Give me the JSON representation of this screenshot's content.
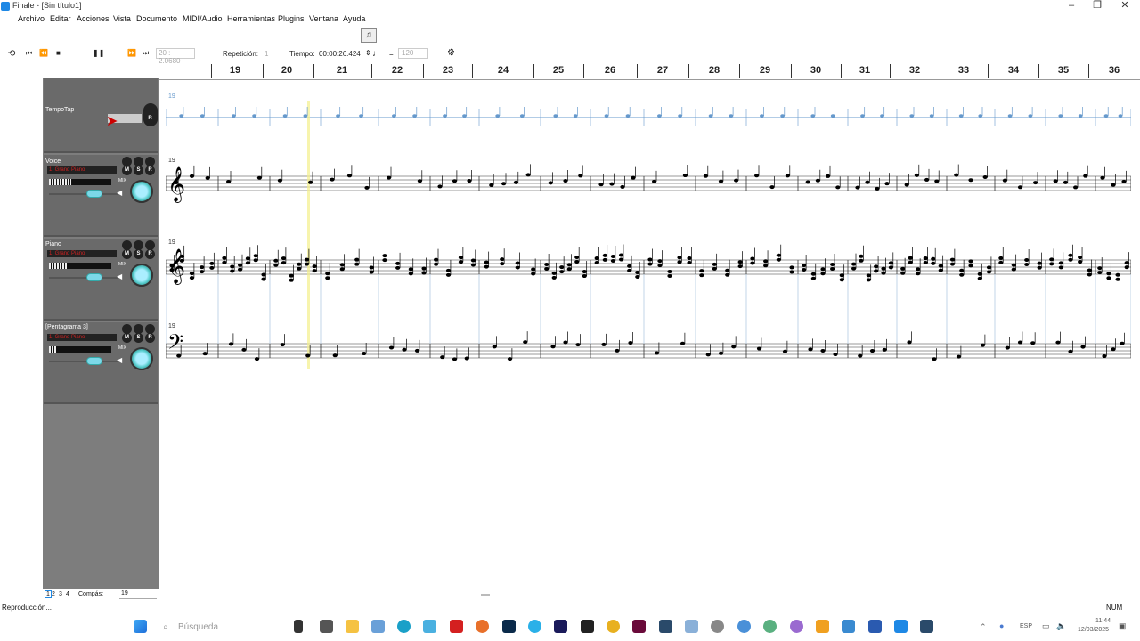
{
  "window": {
    "title": "Finale - [Sin título1]"
  },
  "menu": [
    "Archivo",
    "Editar",
    "Acciones",
    "Vista",
    "Documento",
    "MIDI/Audio",
    "Herramientas",
    "Plugins",
    "Ventana",
    "Ayuda"
  ],
  "transport": {
    "counter": "20 : 2.0680",
    "repeat_label": "Repetición:",
    "repeat_value": "1",
    "time_label": "Tiempo:",
    "time_value": "00:00:26.424",
    "eq": "=",
    "tempo_value": "120"
  },
  "measures": [
    "19",
    "20",
    "21",
    "22",
    "23",
    "24",
    "25",
    "26",
    "27",
    "28",
    "29",
    "30",
    "31",
    "32",
    "33",
    "34",
    "35",
    "36"
  ],
  "tracks": [
    {
      "name": "TempoTap",
      "instrument": ""
    },
    {
      "name": "Voice",
      "instrument": "1. Grand Piano",
      "level": 0.35
    },
    {
      "name": "Piano",
      "instrument": "1. Grand Piano",
      "level": 0.3
    },
    {
      "name": "[Pentagrama 3]",
      "instrument": "1. Grand Piano",
      "level": 0.12
    }
  ],
  "track_buttons": {
    "m": "M",
    "s": "S",
    "r": "R",
    "mix": "MIX"
  },
  "staff_labels": {
    "tempo": "19",
    "voice": "19",
    "piano": "19",
    "bass": "19"
  },
  "page_tabs": [
    "1",
    "2",
    "3",
    "4"
  ],
  "measure_field": {
    "label": "Compás:",
    "value": "19"
  },
  "status": {
    "text": "Reproducción...",
    "num": "NUM"
  },
  "taskbar": {
    "search_placeholder": "Búsqueda",
    "lang": "ESP",
    "time": "11:44",
    "date": "12/03/2025"
  },
  "colors": {
    "accent": "#1e88e5",
    "panel": "#7d7d7d",
    "playhead": "#f3f08a"
  }
}
